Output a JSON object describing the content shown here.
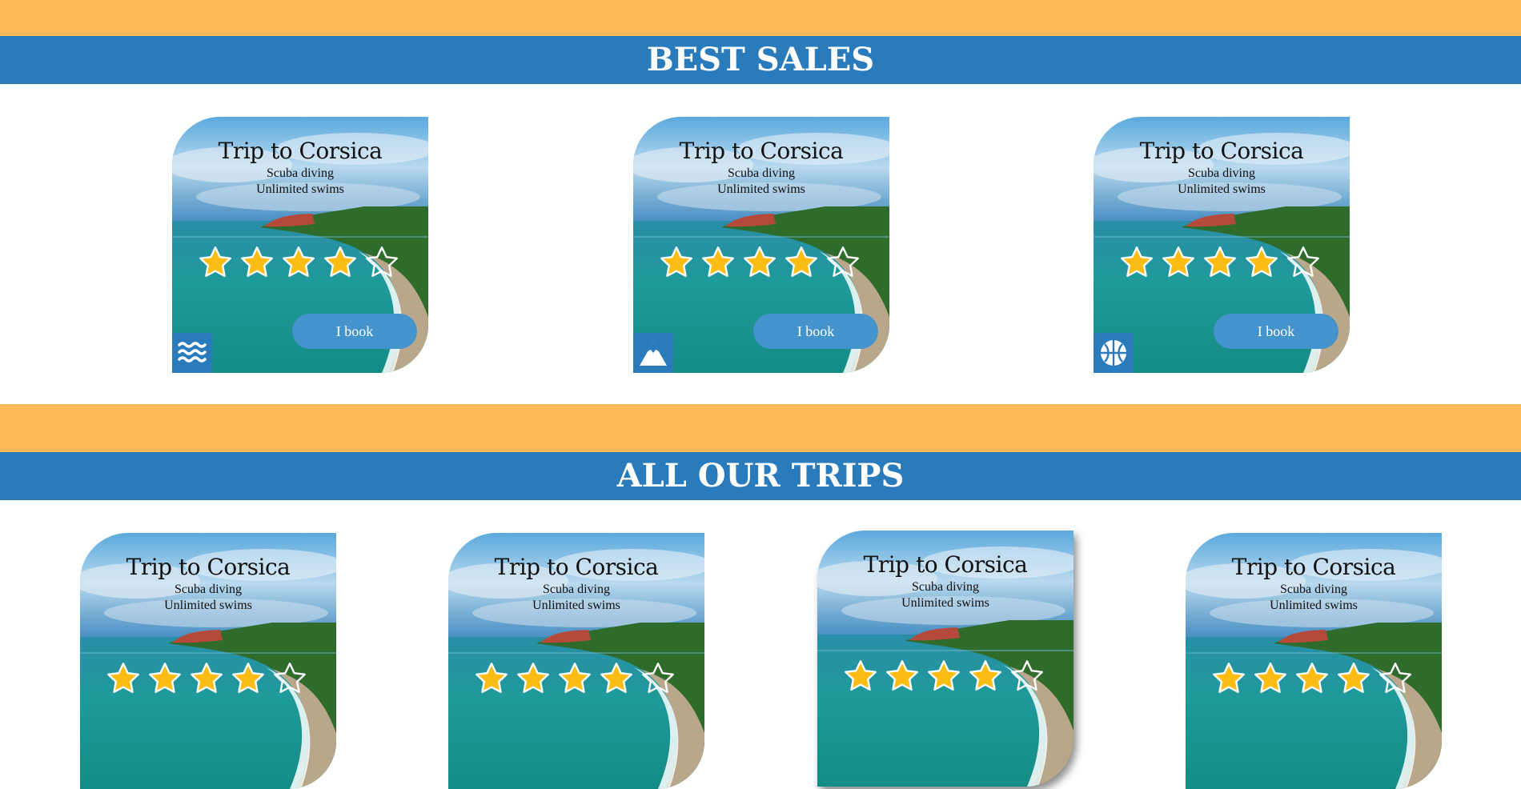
{
  "colors": {
    "orange": "#fdba57",
    "blue": "#2a7bbc",
    "button": "#4593cc",
    "star_fill": "#fbbd14",
    "white": "#ffffff"
  },
  "best_sales": {
    "heading": "BEST SALES",
    "cards": [
      {
        "title": "Trip to Corsica",
        "line1": "Scuba diving",
        "line2": "Unlimited swims",
        "rating": 4,
        "max_rating": 5,
        "button_label": "I book",
        "category_icon": "waves-icon"
      },
      {
        "title": "Trip to Corsica",
        "line1": "Scuba diving",
        "line2": "Unlimited swims",
        "rating": 4,
        "max_rating": 5,
        "button_label": "I book",
        "category_icon": "mountain-icon"
      },
      {
        "title": "Trip to Corsica",
        "line1": "Scuba diving",
        "line2": "Unlimited swims",
        "rating": 4,
        "max_rating": 5,
        "button_label": "I book",
        "category_icon": "basketball-icon"
      }
    ]
  },
  "all_trips": {
    "heading": "ALL OUR TRIPS",
    "cards": [
      {
        "title": "Trip to Corsica",
        "line1": "Scuba diving",
        "line2": "Unlimited swims",
        "rating": 4,
        "max_rating": 5
      },
      {
        "title": "Trip to Corsica",
        "line1": "Scuba diving",
        "line2": "Unlimited swims",
        "rating": 4,
        "max_rating": 5
      },
      {
        "title": "Trip to Corsica",
        "line1": "Scuba diving",
        "line2": "Unlimited swims",
        "rating": 4,
        "max_rating": 5
      },
      {
        "title": "Trip to Corsica",
        "line1": "Scuba diving",
        "line2": "Unlimited swims",
        "rating": 4,
        "max_rating": 5
      }
    ]
  }
}
